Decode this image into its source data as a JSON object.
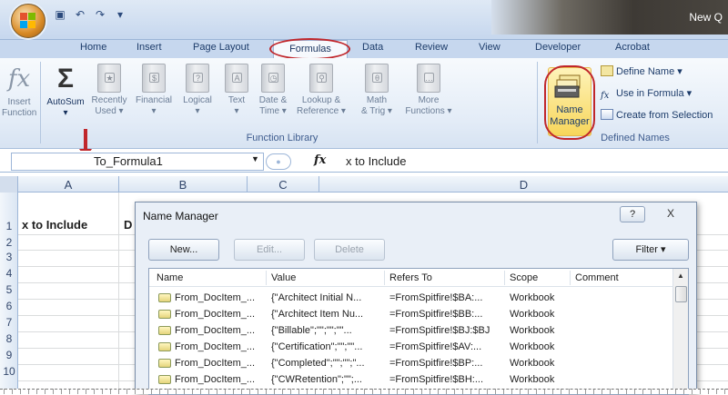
{
  "window": {
    "title": "New Q"
  },
  "tabs": [
    "Home",
    "Insert",
    "Page Layout",
    "Formulas",
    "Data",
    "Review",
    "View",
    "Developer",
    "Acrobat"
  ],
  "ribbon": {
    "insert_function": [
      "Insert",
      "Function"
    ],
    "autosum": "AutoSum",
    "recently_used": [
      "Recently",
      "Used"
    ],
    "financial": "Financial",
    "logical": "Logical",
    "text": "Text",
    "date_time": [
      "Date &",
      "Time"
    ],
    "lookup": [
      "Lookup &",
      "Reference"
    ],
    "math": [
      "Math",
      "& Trig"
    ],
    "more": [
      "More",
      "Functions"
    ],
    "group_function_library": "Function Library",
    "name_manager": [
      "Name",
      "Manager"
    ],
    "define_name": "Define Name",
    "use_in_formula": "Use in Formula",
    "create_from_selection": "Create from Selection",
    "group_defined_names": "Defined Names"
  },
  "formula_bar": {
    "name_box": "To_Formula1",
    "fx": "fx",
    "value": "x to Include"
  },
  "sheet": {
    "columns": [
      "A",
      "B",
      "C",
      "D"
    ],
    "rows": [
      "1",
      "2",
      "3",
      "4",
      "5",
      "6",
      "7",
      "8",
      "9",
      "10"
    ],
    "A1": "x to Include",
    "B1": "D"
  },
  "dialog": {
    "title": "Name Manager",
    "help": "?",
    "close": "X",
    "buttons": {
      "new": "New...",
      "edit": "Edit...",
      "delete": "Delete",
      "filter": "Filter"
    },
    "columns": [
      "Name",
      "Value",
      "Refers To",
      "Scope",
      "Comment"
    ],
    "rows": [
      {
        "name": "From_DocItem_...",
        "value": "{\"Architect Initial N...",
        "refers": "=FromSpitfire!$BA:...",
        "scope": "Workbook"
      },
      {
        "name": "From_DocItem_...",
        "value": "{\"Architect Item Nu...",
        "refers": "=FromSpitfire!$BB:...",
        "scope": "Workbook"
      },
      {
        "name": "From_DocItem_...",
        "value": "{\"Billable\";\"\";\"\";\"\"...",
        "refers": "=FromSpitfire!$BJ:$BJ",
        "scope": "Workbook"
      },
      {
        "name": "From_DocItem_...",
        "value": "{\"Certification\";\"\";\"\"...",
        "refers": "=FromSpitfire!$AV:...",
        "scope": "Workbook"
      },
      {
        "name": "From_DocItem_...",
        "value": "{\"Completed\";\"\";\"\";\"...",
        "refers": "=FromSpitfire!$BP:...",
        "scope": "Workbook"
      },
      {
        "name": "From_DocItem_...",
        "value": "{\"CWRetention\";\"\";...",
        "refers": "=FromSpitfire!$BH:...",
        "scope": "Workbook"
      }
    ]
  },
  "colors": {
    "annotation_red": "#c0262b",
    "ribbon_blue": "#c6d7ee",
    "name_manager_highlight": "#f7d65b"
  }
}
